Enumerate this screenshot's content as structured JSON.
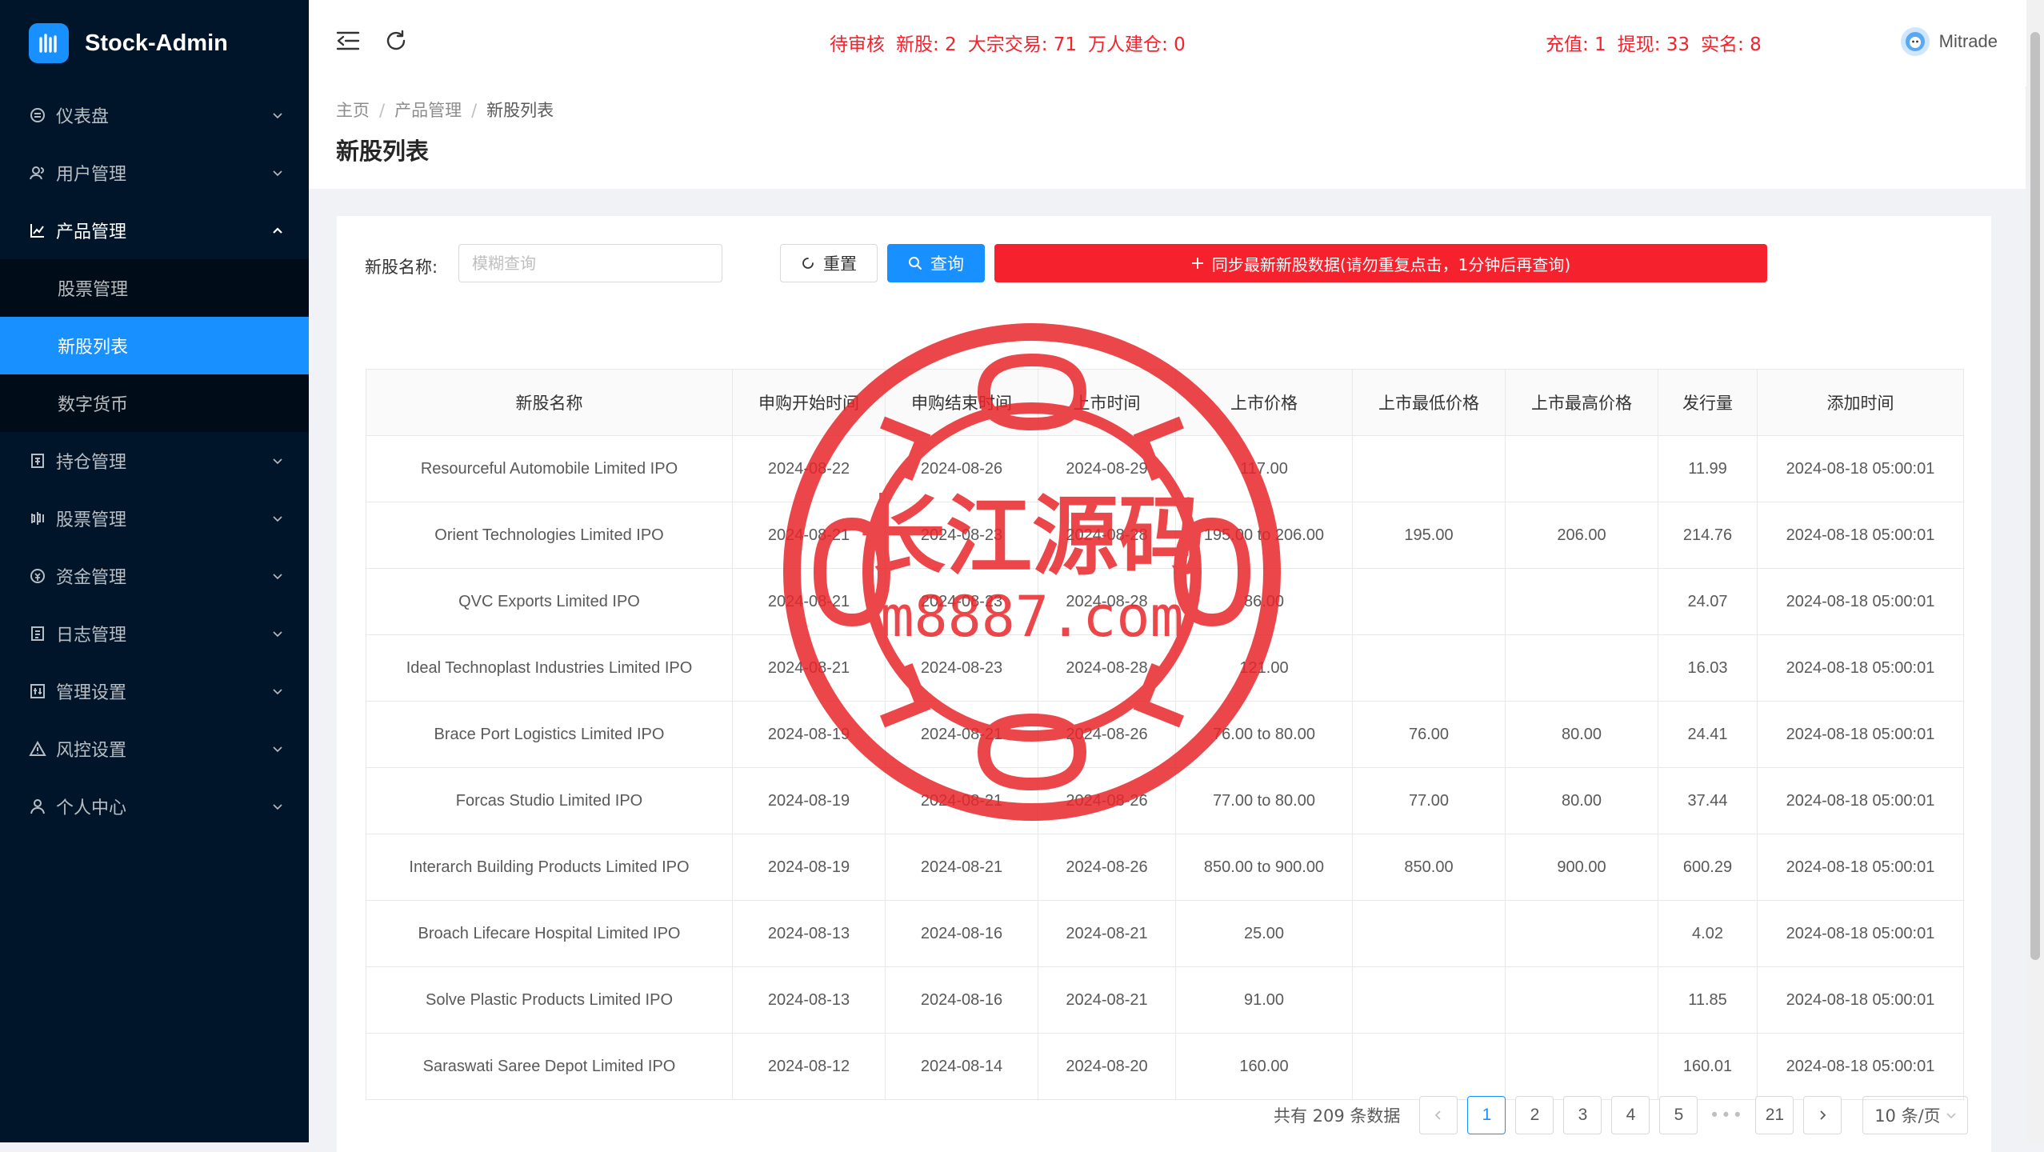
{
  "app": {
    "name": "Stock-Admin"
  },
  "sidebar": {
    "items": [
      {
        "label": "仪表盘",
        "icon": "dashboard-icon"
      },
      {
        "label": "用户管理",
        "icon": "users-icon"
      },
      {
        "label": "产品管理",
        "icon": "chart-icon",
        "open": true,
        "children": [
          {
            "label": "股票管理"
          },
          {
            "label": "新股列表",
            "active": true
          },
          {
            "label": "数字货币"
          }
        ]
      },
      {
        "label": "持仓管理",
        "icon": "position-icon"
      },
      {
        "label": "股票管理",
        "icon": "stock-icon"
      },
      {
        "label": "资金管理",
        "icon": "money-icon"
      },
      {
        "label": "日志管理",
        "icon": "log-icon"
      },
      {
        "label": "管理设置",
        "icon": "settings-icon"
      },
      {
        "label": "风控设置",
        "icon": "warning-icon"
      },
      {
        "label": "个人中心",
        "icon": "user-icon"
      }
    ]
  },
  "header": {
    "notice_left": [
      "待审核",
      "新股: 2",
      "大宗交易: 71",
      "万人建仓: 0"
    ],
    "notice_right": [
      "充值: 1",
      "提现: 33",
      "实名: 8"
    ],
    "username": "Mitrade"
  },
  "breadcrumb": [
    "主页",
    "产品管理",
    "新股列表"
  ],
  "page_title": "新股列表",
  "search": {
    "label": "新股名称:",
    "placeholder": "模糊查询",
    "value": "",
    "reset_label": "重置",
    "query_label": "查询",
    "sync_label": "同步最新新股数据(请勿重复点击，1分钟后再查询)"
  },
  "table": {
    "columns": [
      "新股名称",
      "申购开始时间",
      "申购结束时间",
      "上市时间",
      "上市价格",
      "上市最低价格",
      "上市最高价格",
      "发行量",
      "添加时间"
    ],
    "rows": [
      [
        "Resourceful Automobile Limited IPO",
        "2024-08-22",
        "2024-08-26",
        "2024-08-29",
        "117.00",
        "",
        "",
        "11.99",
        "2024-08-18 05:00:01"
      ],
      [
        "Orient Technologies Limited IPO",
        "2024-08-21",
        "2024-08-23",
        "2024-08-28",
        "195.00 to 206.00",
        "195.00",
        "206.00",
        "214.76",
        "2024-08-18 05:00:01"
      ],
      [
        "QVC Exports Limited IPO",
        "2024-08-21",
        "2024-08-23",
        "2024-08-28",
        "86.00",
        "",
        "",
        "24.07",
        "2024-08-18 05:00:01"
      ],
      [
        "Ideal Technoplast Industries Limited IPO",
        "2024-08-21",
        "2024-08-23",
        "2024-08-28",
        "121.00",
        "",
        "",
        "16.03",
        "2024-08-18 05:00:01"
      ],
      [
        "Brace Port Logistics Limited IPO",
        "2024-08-19",
        "2024-08-21",
        "2024-08-26",
        "76.00 to 80.00",
        "76.00",
        "80.00",
        "24.41",
        "2024-08-18 05:00:01"
      ],
      [
        "Forcas Studio Limited IPO",
        "2024-08-19",
        "2024-08-21",
        "2024-08-26",
        "77.00 to 80.00",
        "77.00",
        "80.00",
        "37.44",
        "2024-08-18 05:00:01"
      ],
      [
        "Interarch Building Products Limited IPO",
        "2024-08-19",
        "2024-08-21",
        "2024-08-26",
        "850.00 to 900.00",
        "850.00",
        "900.00",
        "600.29",
        "2024-08-18 05:00:01"
      ],
      [
        "Broach Lifecare Hospital Limited IPO",
        "2024-08-13",
        "2024-08-16",
        "2024-08-21",
        "25.00",
        "",
        "",
        "4.02",
        "2024-08-18 05:00:01"
      ],
      [
        "Solve Plastic Products Limited IPO",
        "2024-08-13",
        "2024-08-16",
        "2024-08-21",
        "91.00",
        "",
        "",
        "11.85",
        "2024-08-18 05:00:01"
      ],
      [
        "Saraswati Saree Depot Limited IPO",
        "2024-08-12",
        "2024-08-14",
        "2024-08-20",
        "160.00",
        "",
        "",
        "160.01",
        "2024-08-18 05:00:01"
      ]
    ]
  },
  "pagination": {
    "total_label": "共有 209 条数据",
    "pages": [
      "1",
      "2",
      "3",
      "4",
      "5"
    ],
    "current": "1",
    "ellipsis": "•••",
    "last_page": "21",
    "page_size": "10 条/页"
  },
  "watermark": {
    "line1": "长江源码",
    "line2": "m8887.com",
    "color": "#e8262b"
  },
  "colors": {
    "sidebar_bg": "#001529",
    "accent": "#1890ff",
    "danger": "#f5222d"
  }
}
